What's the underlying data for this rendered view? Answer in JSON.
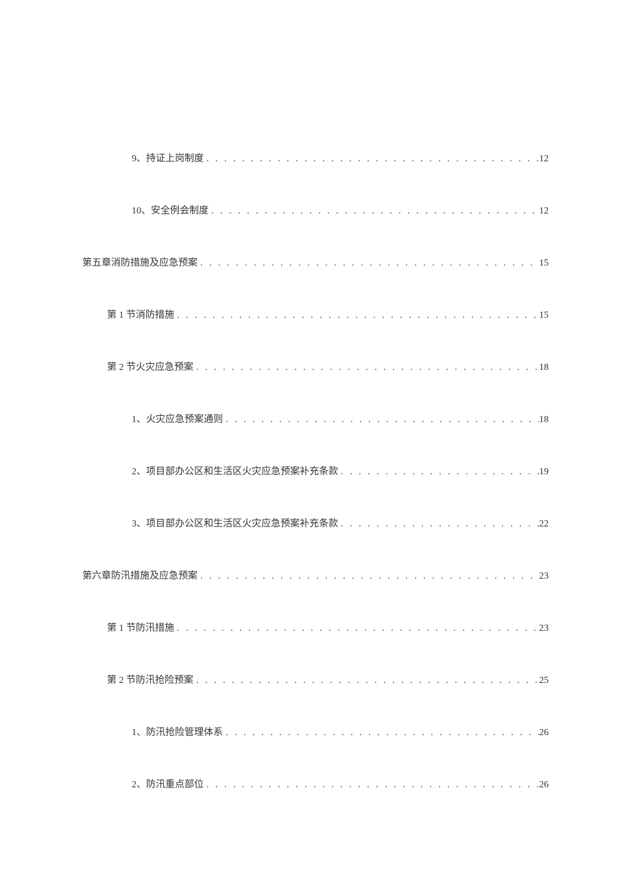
{
  "toc": [
    {
      "level": 2,
      "label": "9、持证上岗制度",
      "page": "12"
    },
    {
      "level": 2,
      "label": "10、安全例会制度",
      "page": "12"
    },
    {
      "level": 0,
      "label": "第五章消防措施及应急预案",
      "page": "15"
    },
    {
      "level": 1,
      "label": "第 1 节消防措施",
      "page": "15"
    },
    {
      "level": 1,
      "label": "第 2 节火灾应急预案",
      "page": "18"
    },
    {
      "level": 2,
      "label": "1、火灾应急预案通则",
      "page": "18"
    },
    {
      "level": 2,
      "label": "2、项目部办公区和生活区火灾应急预案补充条款",
      "page": "19"
    },
    {
      "level": 2,
      "label": "3、项目部办公区和生活区火灾应急预案补充条款",
      "page": "22"
    },
    {
      "level": 0,
      "label": "第六章防汛措施及应急预案",
      "page": "23"
    },
    {
      "level": 1,
      "label": "第 1 节防汛措施",
      "page": "23"
    },
    {
      "level": 1,
      "label": "第 2 节防汛抢险预案",
      "page": "25"
    },
    {
      "level": 2,
      "label": "1、防汛抢险管理体系",
      "page": "26"
    },
    {
      "level": 2,
      "label": "2、防汛重点部位",
      "page": "26"
    }
  ]
}
